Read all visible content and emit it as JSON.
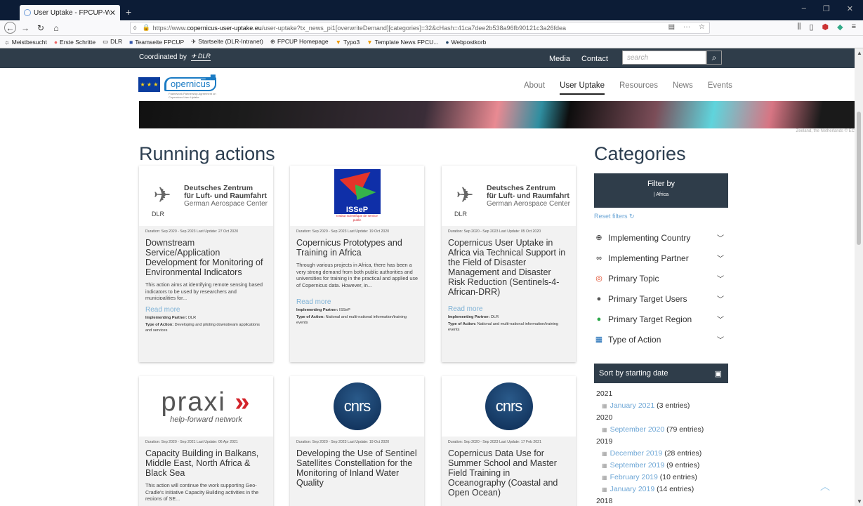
{
  "browser": {
    "tab_title": "User Uptake - FPCUP-Website",
    "tab_close": "✕",
    "new_tab": "+",
    "url_prefix": "https://www.",
    "url_domain": "copernicus-user-uptake.eu",
    "url_rest": "/user-uptake?tx_news_pi1[overwriteDemand][categories]=32&cHash=41ca7dee2b538a96fb90121c3a26fdea",
    "bookmarks": [
      "Meistbesucht",
      "Erste Schritte",
      "DLR",
      "Teamseite FPCUP",
      "Startseite (DLR-Intranet)",
      "FPCUP Homepage",
      "Typo3",
      "Template News FPCU...",
      "Webpostkorb"
    ]
  },
  "site": {
    "coordinated_by": "Coordinated by",
    "dlr": "DLR",
    "top_links": [
      "Media",
      "Contact"
    ],
    "search_placeholder": "search",
    "eu_stars": "★ ★ ★",
    "copernicus": "opernicus",
    "copernicus_sub": "Framework Partnership Agreement on Copernicus User Uptake",
    "nav": [
      "About",
      "User Uptake",
      "Resources",
      "News",
      "Events"
    ],
    "banner_caption": "Zeeland, the Netherlands © EC"
  },
  "main": {
    "heading": "Running actions",
    "read_more": "Read more",
    "partner_label": "Implementing Partner:",
    "type_label": "Type of Action:",
    "cards": [
      {
        "logo": "DLR",
        "meta": "Duration: Sep 2020 - Sep 2023 Last Update: 27 Oct 2020",
        "title": "Downstream Service/Application Development for Monitoring of Environmental Indicators",
        "desc": "This action aims at identifying remote sensing based indicators to be used by researchers and municipalities for...",
        "partner": "DLR",
        "type": "Developing and piloting downstream applications and services"
      },
      {
        "logo": "ISSeP",
        "meta": "Duration: Sep 2020 - Sep 2023 Last Update: 19 Oct 2020",
        "title": "Copernicus Prototypes and Training in Africa",
        "desc": "Through various projects in Africa, there has been a very strong demand from both public authorities and universities for training in the practical and applied use of Copernicus data. However, in...",
        "partner": "ISSeP",
        "type": "National and multi-national information/training events"
      },
      {
        "logo": "DLR",
        "meta": "Duration: Sep 2020 - Sep 2023 Last Update: 05 Oct 2020",
        "title": "Copernicus User Uptake in Africa via Technical Support in the Field of Disaster Management and Disaster Risk Reduction (Sentinels-4-African-DRR)",
        "desc": "",
        "partner": "DLR",
        "type": "National and multi-national information/training events"
      },
      {
        "logo": "praxi",
        "meta": "Duration: Sep 2020 - Sep 2021 Last Update: 06 Apr 2021",
        "title": "Capacity Building in Balkans, Middle East, North Africa & Black Sea",
        "desc": "This action will continue the work supporting Geo-Cradle's Initiative Capacity Building activities in the regions of SE..."
      },
      {
        "logo": "cnrs",
        "meta": "Duration: Sep 2020 - Sep 2023 Last Update: 19 Oct 2020",
        "title": "Developing the Use of Sentinel Satellites Constellation for the Monitoring of Inland Water Quality",
        "desc": ""
      },
      {
        "logo": "cnrs",
        "meta": "Duration: Sep 2020 - Sep 2023 Last Update: 17 Feb 2021",
        "title": "Copernicus Data Use for Summer School and Master Field Training in Oceanography (Coastal and Open Ocean)",
        "desc": ""
      }
    ],
    "dlr_logo": {
      "line1": "Deutsches Zentrum",
      "line2": "für Luft- und Raumfahrt",
      "line3": "German Aerospace Center",
      "mark": "DLR"
    },
    "issep_logo": {
      "name": "ISSeP",
      "sub": "Institut scientifique de service public"
    },
    "praxi_logo": {
      "word": "praxi",
      "arrows": "»",
      "tagline": "help-forward network"
    },
    "cnrs_logo": "cnrs"
  },
  "sidebar": {
    "heading": "Categories",
    "filter_by": "Filter by",
    "filter_value": "| Africa",
    "reset": "Reset filters",
    "categories": [
      {
        "label": "Implementing Country",
        "icon": "globe-icon",
        "glyph": "🌐",
        "color": "#333333"
      },
      {
        "label": "Implementing Partner",
        "icon": "link-icon",
        "glyph": "∞",
        "color": "#333333"
      },
      {
        "label": "Primary Topic",
        "icon": "target-icon",
        "glyph": "◎",
        "color": "#e04a2a"
      },
      {
        "label": "Primary Target Users",
        "icon": "user-icon",
        "glyph": "●",
        "color": "#555555"
      },
      {
        "label": "Primary Target Region",
        "icon": "region-globe-icon",
        "glyph": "●",
        "color": "#2ca84a"
      },
      {
        "label": "Type of Action",
        "icon": "action-grid-icon",
        "glyph": "▦",
        "color": "#1a6ab4"
      }
    ],
    "sort_label": "Sort by starting date",
    "dates": [
      {
        "year": "2021",
        "months": [
          {
            "label": "January 2021",
            "count": "(3 entries)"
          }
        ]
      },
      {
        "year": "2020",
        "months": [
          {
            "label": "September 2020",
            "count": "(79 entries)"
          }
        ]
      },
      {
        "year": "2019",
        "months": [
          {
            "label": "December 2019",
            "count": "(28 entries)"
          },
          {
            "label": "September 2019",
            "count": "(9 entries)"
          },
          {
            "label": "February 2019",
            "count": "(10 entries)"
          },
          {
            "label": "January 2019",
            "count": "(14 entries)"
          }
        ]
      },
      {
        "year": "2018",
        "months": []
      }
    ]
  }
}
